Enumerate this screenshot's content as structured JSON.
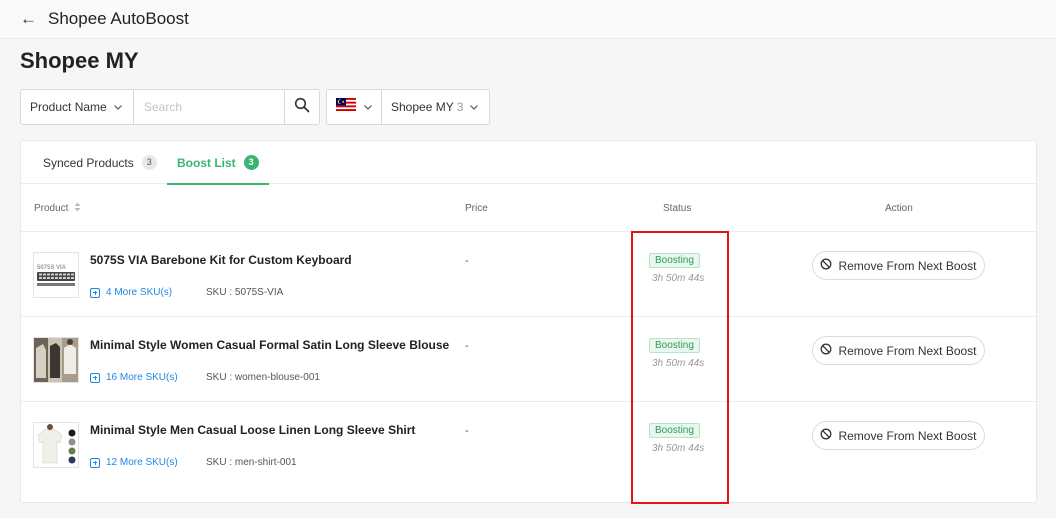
{
  "topbar": {
    "back_icon": "arrow-left-icon",
    "title": "Shopee AutoBoost"
  },
  "page": {
    "title": "Shopee MY"
  },
  "filters": {
    "product_select": "Product Name",
    "search_placeholder": "Search",
    "search_icon": "search-icon",
    "flag_icon": "malaysia-flag-icon",
    "shop_select": "Shopee MY",
    "shop_count": "3"
  },
  "tabs": [
    {
      "label": "Synced Products",
      "count": "3",
      "active": false
    },
    {
      "label": "Boost List",
      "count": "3",
      "active": true
    }
  ],
  "table": {
    "headers": {
      "product": "Product",
      "price": "Price",
      "status": "Status",
      "action": "Action"
    },
    "rows": [
      {
        "name": "5075S VIA Barebone Kit for Custom Keyboard",
        "more_sku": "4 More SKU(s)",
        "sku": "SKU : 5075S-VIA",
        "price": "-",
        "status": "Boosting",
        "time": "3h 50m 44s",
        "action": "Remove From Next Boost",
        "thumb_icon": "keyboard-kit-icon"
      },
      {
        "name": "Minimal Style Women Casual Formal Satin Long Sleeve Blouse",
        "more_sku": "16 More SKU(s)",
        "sku": "SKU : women-blouse-001",
        "price": "-",
        "status": "Boosting",
        "time": "3h 50m 44s",
        "action": "Remove From Next Boost",
        "thumb_icon": "blouse-photo-icon"
      },
      {
        "name": "Minimal Style Men Casual Loose Linen Long Sleeve Shirt",
        "more_sku": "12 More SKU(s)",
        "sku": "SKU : men-shirt-001",
        "price": "-",
        "status": "Boosting",
        "time": "3h 50m 44s",
        "action": "Remove From Next Boost",
        "thumb_icon": "shirt-photo-icon"
      }
    ]
  },
  "colors": {
    "accent_green": "#3cb371",
    "link_blue": "#1e88e5",
    "highlight_red": "#e0161b"
  }
}
